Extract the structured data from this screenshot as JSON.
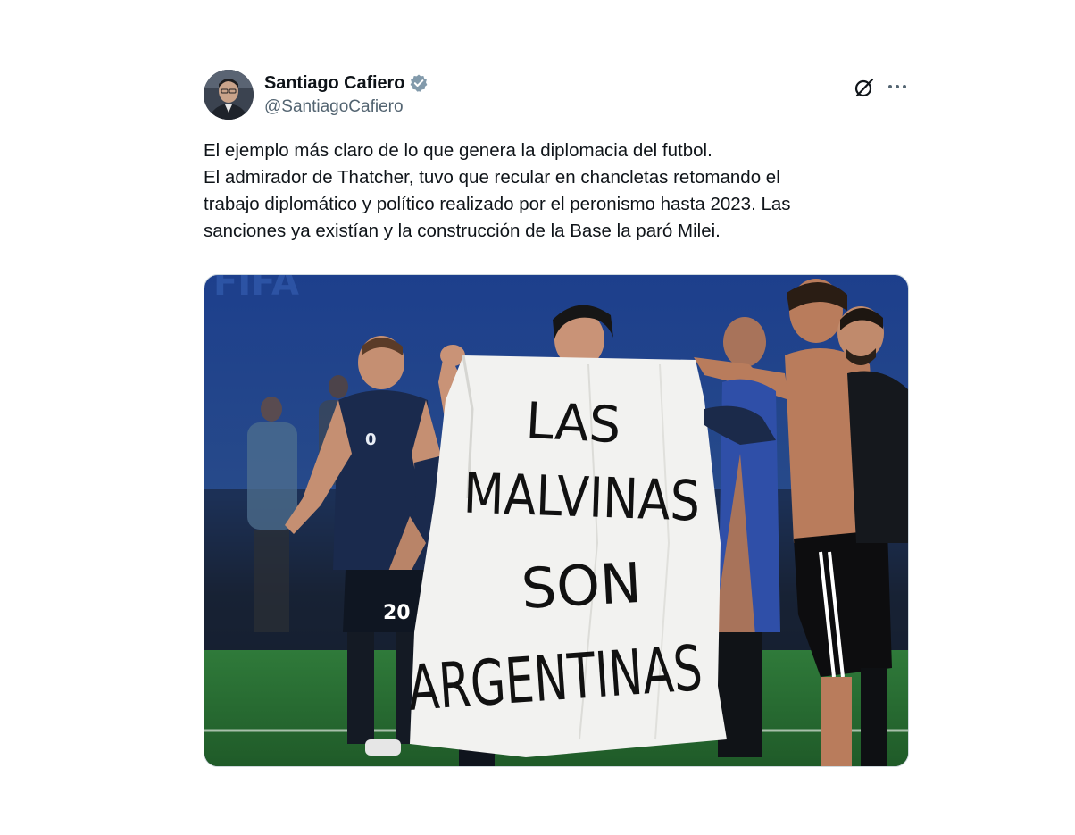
{
  "author": {
    "display_name": "Santiago Cafiero",
    "handle": "@SantiagoCafiero",
    "verified": true,
    "verified_color": "#829aab"
  },
  "icons": {
    "grok": "grok-icon",
    "more": "more-icon"
  },
  "tweet": {
    "lines": [
      "El ejemplo más claro de lo que genera la diplomacia del futbol.",
      "El admirador de Thatcher, tuvo que recular en chancletas retomando el",
      "trabajo diplomático y político realizado por el peronismo hasta 2023. Las",
      "sanciones ya existían y la construcción de la Base la paró Milei."
    ]
  },
  "media": {
    "banner_lines": [
      "LAS",
      "MALVINAS",
      "SON",
      "ARGENTINAS"
    ],
    "jersey_number": "20"
  }
}
